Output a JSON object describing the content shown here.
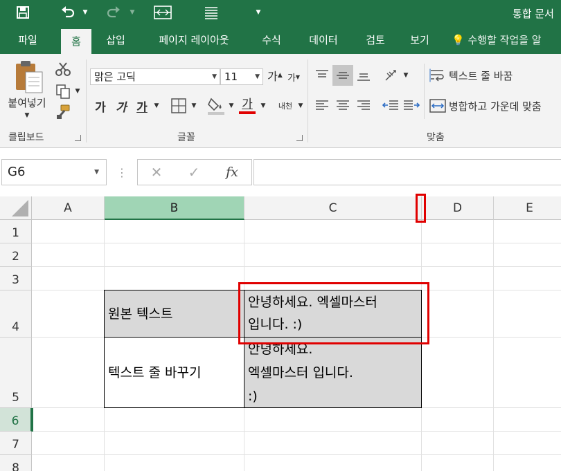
{
  "document": {
    "title": "통합 문서"
  },
  "tabs": [
    {
      "label": "파일",
      "active": false
    },
    {
      "label": "홈",
      "active": true
    },
    {
      "label": "삽입",
      "active": false
    },
    {
      "label": "페이지 레이아웃",
      "active": false
    },
    {
      "label": "수식",
      "active": false
    },
    {
      "label": "데이터",
      "active": false
    },
    {
      "label": "검토",
      "active": false
    },
    {
      "label": "보기",
      "active": false
    }
  ],
  "tell_me": "수행할 작업을 알",
  "ribbon": {
    "clipboard": {
      "label": "클립보드",
      "paste_label": "붙여넣기"
    },
    "font": {
      "label": "글꼴",
      "font_name": "맑은 고딕",
      "font_size": "11",
      "bold": "가",
      "italic": "가",
      "underline": "가",
      "grow": "가",
      "shrink": "가",
      "font_color_char": "가",
      "phonetic": "내천"
    },
    "alignment": {
      "label": "맞춤",
      "wrap_text": "텍스트 줄 바꿈",
      "merge_center": "병합하고 가운데 맞춤"
    }
  },
  "formula_bar": {
    "name_box": "G6",
    "fx": "fx",
    "value": ""
  },
  "columns": [
    "A",
    "B",
    "C",
    "D",
    "E"
  ],
  "rows": [
    "1",
    "2",
    "3",
    "4",
    "5",
    "6",
    "7",
    "8"
  ],
  "selected": {
    "column": "B",
    "row": "6"
  },
  "cells": {
    "B4": "원본 텍스트",
    "C4": "안녕하세요. 엑셀마스터\n입니다. :)",
    "B5": "텍스트 줄 바꾸기",
    "C5": "안녕하세요.\n엑셀마스터 입니다.\n:)"
  },
  "colors": {
    "excel_green": "#217346",
    "highlight_red": "#e00000",
    "cell_gray": "#d9d9d9"
  }
}
